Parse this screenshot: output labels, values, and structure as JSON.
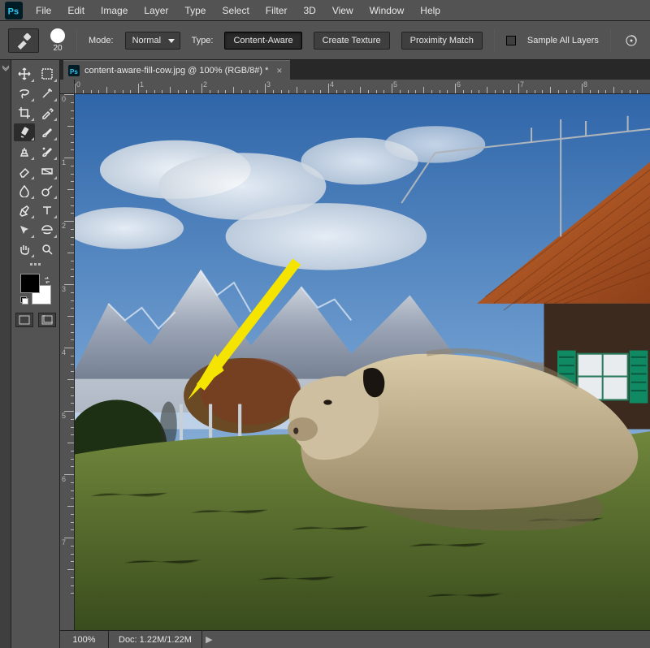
{
  "menu": {
    "items": [
      "File",
      "Edit",
      "Image",
      "Layer",
      "Type",
      "Select",
      "Filter",
      "3D",
      "View",
      "Window",
      "Help"
    ]
  },
  "options": {
    "brush_size": "20",
    "mode_label": "Mode:",
    "mode_value": "Normal",
    "type_label": "Type:",
    "buttons": [
      "Content-Aware",
      "Create Texture",
      "Proximity Match"
    ],
    "active_button_index": 0,
    "sample_all": "Sample All Layers"
  },
  "document": {
    "tab_title": "content-aware-fill-cow.jpg @ 100% (RGB/8#) *",
    "zoom": "100%",
    "doc_info": "Doc: 1.22M/1.22M",
    "ruler_h": [
      "0",
      "1",
      "2",
      "3",
      "4",
      "5",
      "6",
      "7",
      "8"
    ],
    "ruler_v": [
      "0",
      "1",
      "2",
      "3",
      "4",
      "5",
      "6",
      "7"
    ]
  },
  "tools": {
    "rows": [
      [
        "move",
        "marquee"
      ],
      [
        "lasso",
        "magic-wand"
      ],
      [
        "crop",
        "eyedropper"
      ],
      [
        "spot-heal",
        "brush"
      ],
      [
        "clone-stamp",
        "history-brush"
      ],
      [
        "eraser",
        "gradient"
      ],
      [
        "blur",
        "dodge"
      ],
      [
        "pen",
        "type"
      ],
      [
        "path-select",
        "shape"
      ],
      [
        "hand",
        "zoom"
      ]
    ],
    "selected": "spot-heal"
  },
  "colors": {
    "fg": "#000000",
    "bg": "#ffffff"
  }
}
